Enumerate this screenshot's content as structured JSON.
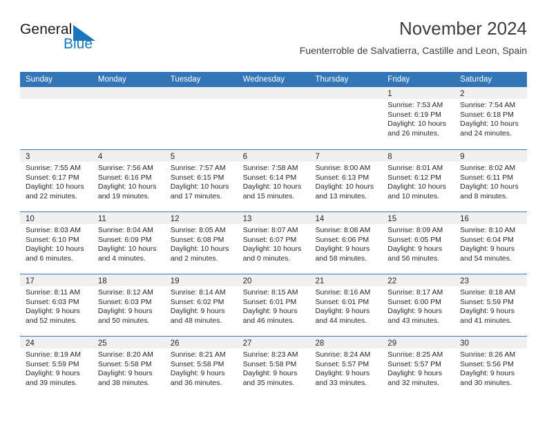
{
  "brand": {
    "name_part1": "General",
    "name_part2": "Blue",
    "flag_icon": "brand-flag-icon",
    "flag_color": "#1b75bb"
  },
  "header": {
    "title": "November 2024",
    "subtitle": "Fuenterroble de Salvatierra, Castille and Leon, Spain"
  },
  "colors": {
    "header_blue": "#3276b8",
    "day_band_gray": "#f0f0f0",
    "text": "#262626",
    "brand_blue": "#1b75bb"
  },
  "calendar": {
    "weekdays": [
      "Sunday",
      "Monday",
      "Tuesday",
      "Wednesday",
      "Thursday",
      "Friday",
      "Saturday"
    ],
    "weeks": [
      [
        {
          "day": "",
          "lines": []
        },
        {
          "day": "",
          "lines": []
        },
        {
          "day": "",
          "lines": []
        },
        {
          "day": "",
          "lines": []
        },
        {
          "day": "",
          "lines": []
        },
        {
          "day": "1",
          "lines": [
            "Sunrise: 7:53 AM",
            "Sunset: 6:19 PM",
            "Daylight: 10 hours",
            "and 26 minutes."
          ]
        },
        {
          "day": "2",
          "lines": [
            "Sunrise: 7:54 AM",
            "Sunset: 6:18 PM",
            "Daylight: 10 hours",
            "and 24 minutes."
          ]
        }
      ],
      [
        {
          "day": "3",
          "lines": [
            "Sunrise: 7:55 AM",
            "Sunset: 6:17 PM",
            "Daylight: 10 hours",
            "and 22 minutes."
          ]
        },
        {
          "day": "4",
          "lines": [
            "Sunrise: 7:56 AM",
            "Sunset: 6:16 PM",
            "Daylight: 10 hours",
            "and 19 minutes."
          ]
        },
        {
          "day": "5",
          "lines": [
            "Sunrise: 7:57 AM",
            "Sunset: 6:15 PM",
            "Daylight: 10 hours",
            "and 17 minutes."
          ]
        },
        {
          "day": "6",
          "lines": [
            "Sunrise: 7:58 AM",
            "Sunset: 6:14 PM",
            "Daylight: 10 hours",
            "and 15 minutes."
          ]
        },
        {
          "day": "7",
          "lines": [
            "Sunrise: 8:00 AM",
            "Sunset: 6:13 PM",
            "Daylight: 10 hours",
            "and 13 minutes."
          ]
        },
        {
          "day": "8",
          "lines": [
            "Sunrise: 8:01 AM",
            "Sunset: 6:12 PM",
            "Daylight: 10 hours",
            "and 10 minutes."
          ]
        },
        {
          "day": "9",
          "lines": [
            "Sunrise: 8:02 AM",
            "Sunset: 6:11 PM",
            "Daylight: 10 hours",
            "and 8 minutes."
          ]
        }
      ],
      [
        {
          "day": "10",
          "lines": [
            "Sunrise: 8:03 AM",
            "Sunset: 6:10 PM",
            "Daylight: 10 hours",
            "and 6 minutes."
          ]
        },
        {
          "day": "11",
          "lines": [
            "Sunrise: 8:04 AM",
            "Sunset: 6:09 PM",
            "Daylight: 10 hours",
            "and 4 minutes."
          ]
        },
        {
          "day": "12",
          "lines": [
            "Sunrise: 8:05 AM",
            "Sunset: 6:08 PM",
            "Daylight: 10 hours",
            "and 2 minutes."
          ]
        },
        {
          "day": "13",
          "lines": [
            "Sunrise: 8:07 AM",
            "Sunset: 6:07 PM",
            "Daylight: 10 hours",
            "and 0 minutes."
          ]
        },
        {
          "day": "14",
          "lines": [
            "Sunrise: 8:08 AM",
            "Sunset: 6:06 PM",
            "Daylight: 9 hours",
            "and 58 minutes."
          ]
        },
        {
          "day": "15",
          "lines": [
            "Sunrise: 8:09 AM",
            "Sunset: 6:05 PM",
            "Daylight: 9 hours",
            "and 56 minutes."
          ]
        },
        {
          "day": "16",
          "lines": [
            "Sunrise: 8:10 AM",
            "Sunset: 6:04 PM",
            "Daylight: 9 hours",
            "and 54 minutes."
          ]
        }
      ],
      [
        {
          "day": "17",
          "lines": [
            "Sunrise: 8:11 AM",
            "Sunset: 6:03 PM",
            "Daylight: 9 hours",
            "and 52 minutes."
          ]
        },
        {
          "day": "18",
          "lines": [
            "Sunrise: 8:12 AM",
            "Sunset: 6:03 PM",
            "Daylight: 9 hours",
            "and 50 minutes."
          ]
        },
        {
          "day": "19",
          "lines": [
            "Sunrise: 8:14 AM",
            "Sunset: 6:02 PM",
            "Daylight: 9 hours",
            "and 48 minutes."
          ]
        },
        {
          "day": "20",
          "lines": [
            "Sunrise: 8:15 AM",
            "Sunset: 6:01 PM",
            "Daylight: 9 hours",
            "and 46 minutes."
          ]
        },
        {
          "day": "21",
          "lines": [
            "Sunrise: 8:16 AM",
            "Sunset: 6:01 PM",
            "Daylight: 9 hours",
            "and 44 minutes."
          ]
        },
        {
          "day": "22",
          "lines": [
            "Sunrise: 8:17 AM",
            "Sunset: 6:00 PM",
            "Daylight: 9 hours",
            "and 43 minutes."
          ]
        },
        {
          "day": "23",
          "lines": [
            "Sunrise: 8:18 AM",
            "Sunset: 5:59 PM",
            "Daylight: 9 hours",
            "and 41 minutes."
          ]
        }
      ],
      [
        {
          "day": "24",
          "lines": [
            "Sunrise: 8:19 AM",
            "Sunset: 5:59 PM",
            "Daylight: 9 hours",
            "and 39 minutes."
          ]
        },
        {
          "day": "25",
          "lines": [
            "Sunrise: 8:20 AM",
            "Sunset: 5:58 PM",
            "Daylight: 9 hours",
            "and 38 minutes."
          ]
        },
        {
          "day": "26",
          "lines": [
            "Sunrise: 8:21 AM",
            "Sunset: 5:58 PM",
            "Daylight: 9 hours",
            "and 36 minutes."
          ]
        },
        {
          "day": "27",
          "lines": [
            "Sunrise: 8:23 AM",
            "Sunset: 5:58 PM",
            "Daylight: 9 hours",
            "and 35 minutes."
          ]
        },
        {
          "day": "28",
          "lines": [
            "Sunrise: 8:24 AM",
            "Sunset: 5:57 PM",
            "Daylight: 9 hours",
            "and 33 minutes."
          ]
        },
        {
          "day": "29",
          "lines": [
            "Sunrise: 8:25 AM",
            "Sunset: 5:57 PM",
            "Daylight: 9 hours",
            "and 32 minutes."
          ]
        },
        {
          "day": "30",
          "lines": [
            "Sunrise: 8:26 AM",
            "Sunset: 5:56 PM",
            "Daylight: 9 hours",
            "and 30 minutes."
          ]
        }
      ]
    ]
  }
}
